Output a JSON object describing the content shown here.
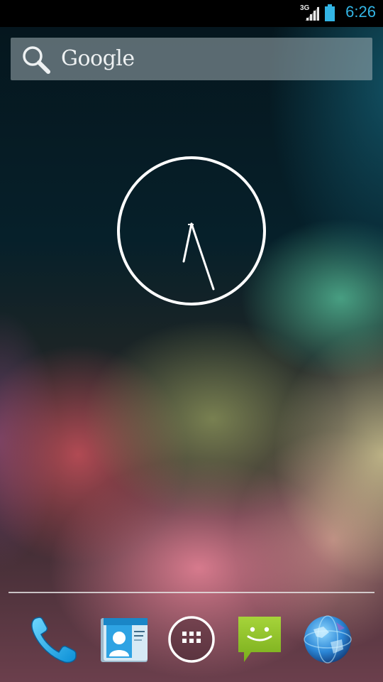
{
  "status_bar": {
    "network_type": "3G",
    "time": "6:26",
    "signal_icon": "cell-signal-icon",
    "battery_icon": "battery-icon",
    "accent_color": "#33b5e5"
  },
  "search": {
    "label": "Google",
    "icon": "search-icon"
  },
  "clock_widget": {
    "type": "analog",
    "time": "6:26"
  },
  "dock": {
    "items": [
      {
        "name": "phone",
        "icon": "phone-icon"
      },
      {
        "name": "people",
        "icon": "contacts-icon"
      },
      {
        "name": "apps",
        "icon": "app-drawer-icon"
      },
      {
        "name": "messaging",
        "icon": "messaging-icon"
      },
      {
        "name": "browser",
        "icon": "browser-globe-icon"
      }
    ]
  }
}
